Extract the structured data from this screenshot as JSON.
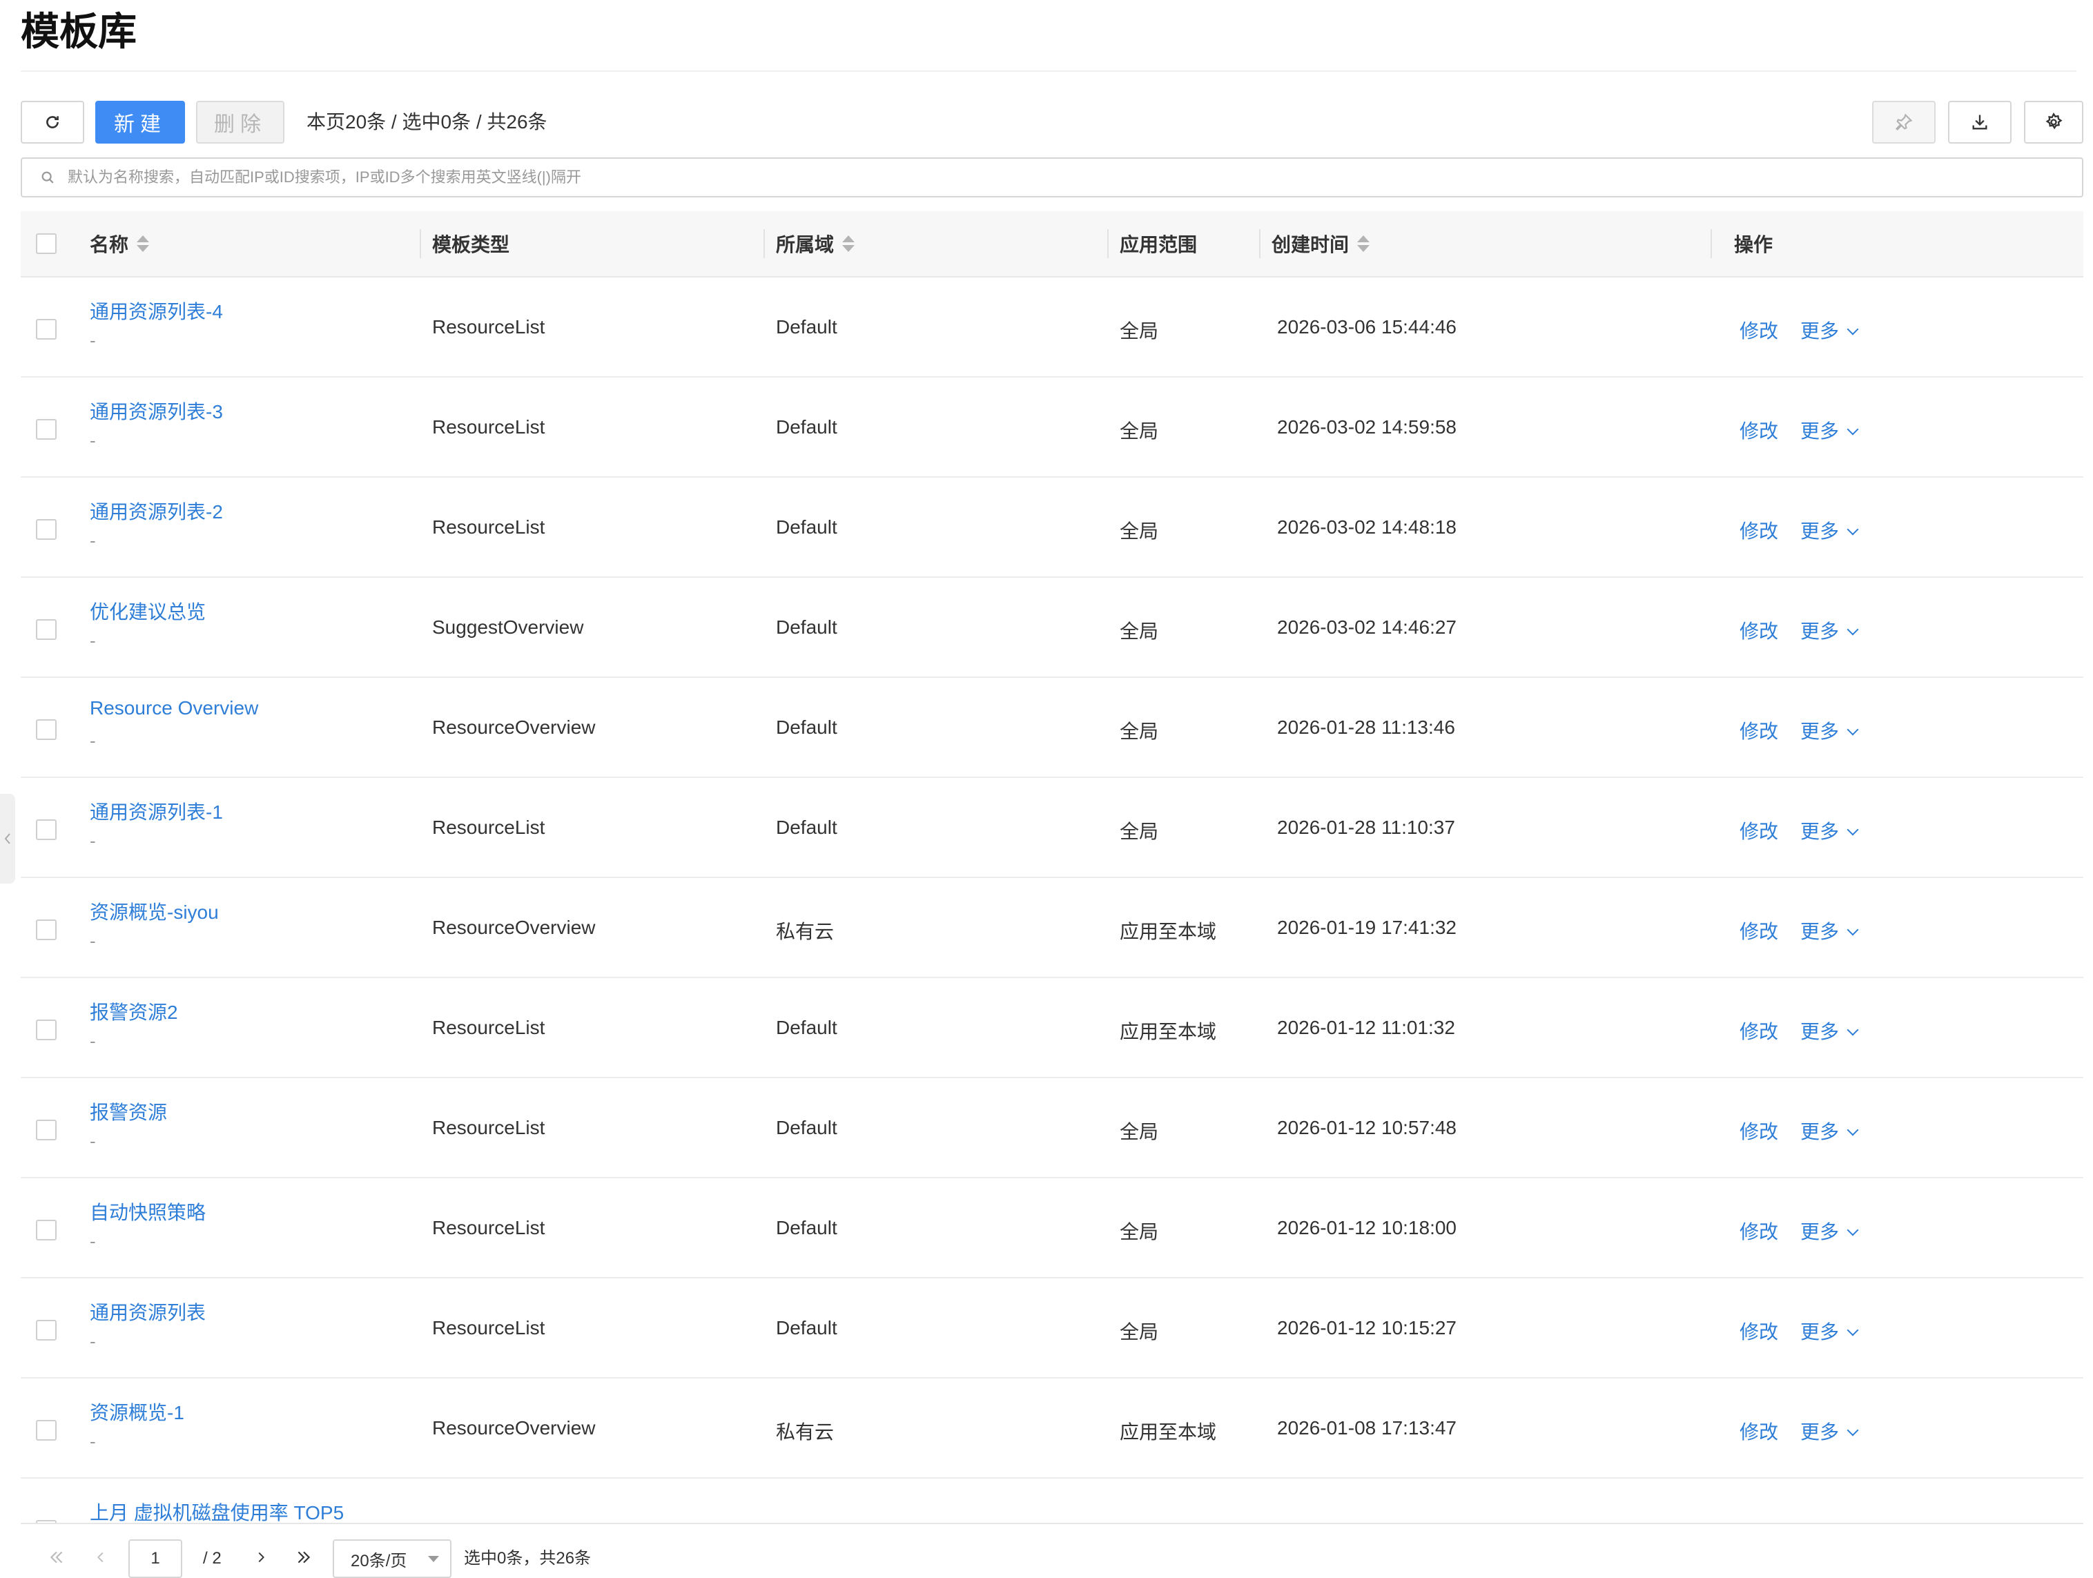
{
  "page": {
    "title": "模板库"
  },
  "toolbar": {
    "refresh_icon": "refresh-icon",
    "new_label": "新建",
    "delete_label": "删除",
    "summary": "本页20条 / 选中0条 / 共26条",
    "pin_icon": "pin-icon",
    "download_icon": "download-icon",
    "settings_icon": "gear-icon"
  },
  "search": {
    "placeholder": "默认为名称搜索，自动匹配IP或ID搜索项，IP或ID多个搜索用英文竖线(|)隔开"
  },
  "table": {
    "columns": [
      {
        "label": "名称",
        "sortable": true
      },
      {
        "label": "模板类型",
        "sortable": false
      },
      {
        "label": "所属域",
        "sortable": true
      },
      {
        "label": "应用范围",
        "sortable": false
      },
      {
        "label": "创建时间",
        "sortable": true
      },
      {
        "label": "操作",
        "sortable": false
      }
    ],
    "rows": [
      {
        "name": "通用资源列表-4",
        "sub": "-",
        "type": "ResourceList",
        "domain": "Default",
        "scope": "全局",
        "created": "2026-03-06 15:44:46",
        "edit": "修改",
        "more": "更多"
      },
      {
        "name": "通用资源列表-3",
        "sub": "-",
        "type": "ResourceList",
        "domain": "Default",
        "scope": "全局",
        "created": "2026-03-02 14:59:58",
        "edit": "修改",
        "more": "更多"
      },
      {
        "name": "通用资源列表-2",
        "sub": "-",
        "type": "ResourceList",
        "domain": "Default",
        "scope": "全局",
        "created": "2026-03-02 14:48:18",
        "edit": "修改",
        "more": "更多"
      },
      {
        "name": "优化建议总览",
        "sub": "-",
        "type": "SuggestOverview",
        "domain": "Default",
        "scope": "全局",
        "created": "2026-03-02 14:46:27",
        "edit": "修改",
        "more": "更多"
      },
      {
        "name": "Resource Overview",
        "sub": "-",
        "type": "ResourceOverview",
        "domain": "Default",
        "scope": "全局",
        "created": "2026-01-28 11:13:46",
        "edit": "修改",
        "more": "更多"
      },
      {
        "name": "通用资源列表-1",
        "sub": "-",
        "type": "ResourceList",
        "domain": "Default",
        "scope": "全局",
        "created": "2026-01-28 11:10:37",
        "edit": "修改",
        "more": "更多"
      },
      {
        "name": "资源概览-siyou",
        "sub": "-",
        "type": "ResourceOverview",
        "domain": "私有云",
        "scope": "应用至本域",
        "created": "2026-01-19 17:41:32",
        "edit": "修改",
        "more": "更多"
      },
      {
        "name": "报警资源2",
        "sub": "-",
        "type": "ResourceList",
        "domain": "Default",
        "scope": "应用至本域",
        "created": "2026-01-12 11:01:32",
        "edit": "修改",
        "more": "更多"
      },
      {
        "name": "报警资源",
        "sub": "-",
        "type": "ResourceList",
        "domain": "Default",
        "scope": "全局",
        "created": "2026-01-12 10:57:48",
        "edit": "修改",
        "more": "更多"
      },
      {
        "name": "自动快照策略",
        "sub": "-",
        "type": "ResourceList",
        "domain": "Default",
        "scope": "全局",
        "created": "2026-01-12 10:18:00",
        "edit": "修改",
        "more": "更多"
      },
      {
        "name": "通用资源列表",
        "sub": "-",
        "type": "ResourceList",
        "domain": "Default",
        "scope": "全局",
        "created": "2026-01-12 10:15:27",
        "edit": "修改",
        "more": "更多"
      },
      {
        "name": "资源概览-1",
        "sub": "-",
        "type": "ResourceOverview",
        "domain": "私有云",
        "scope": "应用至本域",
        "created": "2026-01-08 17:13:47",
        "edit": "修改",
        "more": "更多"
      },
      {
        "name": "上月 虚拟机磁盘使用率 TOP5",
        "sub": "",
        "type": "",
        "domain": "",
        "scope": "",
        "created": "",
        "edit": "",
        "more": ""
      }
    ]
  },
  "pagination": {
    "current_page": "1",
    "total_pages": "/ 2",
    "page_size": "20条/页",
    "status": "选中0条，共26条"
  }
}
